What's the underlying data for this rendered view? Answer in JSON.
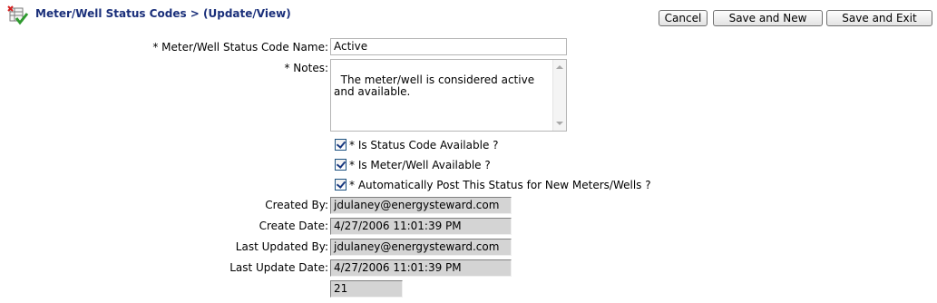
{
  "header": {
    "title": "Meter/Well Status Codes > (Update/View)",
    "icon": "table-edit-icon"
  },
  "toolbar": {
    "cancel_label": "Cancel",
    "save_new_label": "Save and New",
    "save_exit_label": "Save and Exit"
  },
  "form": {
    "name_label": "* Meter/Well Status Code Name:",
    "name_value": "Active",
    "notes_label": "* Notes:",
    "notes_value": "The meter/well is considered active and available.",
    "checkboxes": [
      {
        "label": "* Is Status Code Available ?",
        "checked": true
      },
      {
        "label": "* Is Meter/Well Available ?",
        "checked": true
      },
      {
        "label": "* Automatically Post This Status for New Meters/Wells ?",
        "checked": true
      }
    ],
    "created_by_label": "Created By:",
    "created_by_value": "jdulaney@energysteward.com",
    "create_date_label": "Create Date:",
    "create_date_value": "4/27/2006 11:01:39 PM",
    "last_updated_by_label": "Last Updated By:",
    "last_updated_by_value": "jdulaney@energysteward.com",
    "last_update_date_label": "Last Update Date:",
    "last_update_date_value": "4/27/2006 11:01:39 PM",
    "id_value": "21"
  }
}
